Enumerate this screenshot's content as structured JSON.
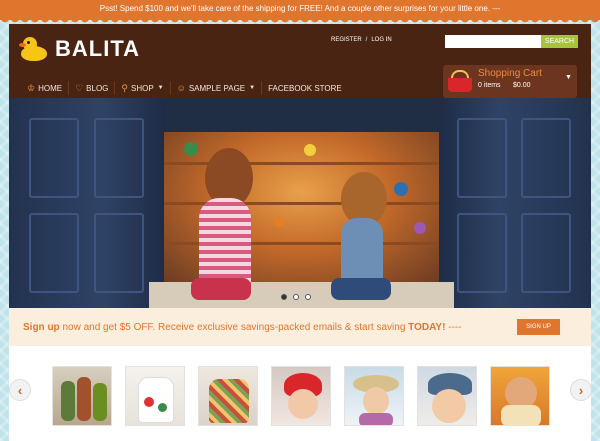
{
  "promo": {
    "text": "Psst! Spend $100 and we'll take care of the shipping for FREE! And a couple other surprises for your little one. ---"
  },
  "brand": {
    "name": "BALITA"
  },
  "top_links": {
    "register": "REGISTER",
    "separator": "/",
    "login": "LOG IN"
  },
  "search": {
    "placeholder": "",
    "button": "SEARCH"
  },
  "nav": {
    "items": [
      {
        "label": "HOME",
        "icon": "crown-icon",
        "dropdown": false
      },
      {
        "label": "BLOG",
        "icon": "heart-icon",
        "dropdown": false
      },
      {
        "label": "SHOP",
        "icon": "shirt-icon",
        "dropdown": true
      },
      {
        "label": "SAMPLE PAGE",
        "icon": "person-icon",
        "dropdown": true
      },
      {
        "label": "FACEBOOK STORE",
        "icon": "",
        "dropdown": false
      }
    ]
  },
  "cart": {
    "title": "Shopping Cart",
    "items": "0 items",
    "total": "$0.00"
  },
  "slider": {
    "slides": 3,
    "active": 1
  },
  "signup": {
    "highlight": "Sign up",
    "text": " now and get $5 OFF. Receive exclusive savings-packed emails & start saving ",
    "emphasis": "TODAY!",
    "trail": " ----",
    "button": "SIGN UP"
  },
  "carousel": {
    "prev_icon": "chevron-left-icon",
    "next_icon": "chevron-right-icon",
    "thumbnails": [
      "toy-figurines",
      "floral-dress",
      "patterned-dress",
      "girl-red-hat",
      "girl-straw-hat",
      "toddler-cap",
      "child-orange-background"
    ]
  },
  "colors": {
    "accent": "#e0762e",
    "header": "#4a2412",
    "search_button": "#a7c33b",
    "background": "#bfe3ea"
  }
}
